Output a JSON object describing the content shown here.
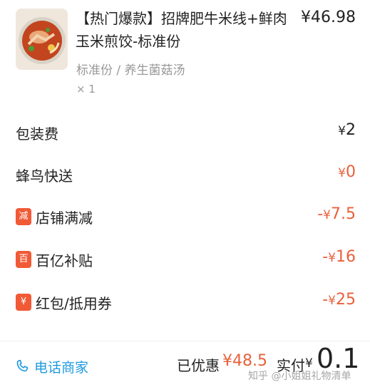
{
  "item": {
    "title": "【热门爆款】招牌肥牛米线+鲜肉玉米煎饺-标准份",
    "price": "¥46.98",
    "spec": "标准份 / 养生菌菇汤",
    "quantity": "× 1"
  },
  "fees": [
    {
      "label": "包装费",
      "yen": "¥",
      "amount": "2",
      "sign": ""
    },
    {
      "label": "蜂鸟快送",
      "yen": "¥",
      "amount": "0",
      "sign": ""
    }
  ],
  "discounts": [
    {
      "badge": "减",
      "label": "店铺满减",
      "sign": "-",
      "yen": "¥",
      "amount": "7.5"
    },
    {
      "badge": "百",
      "label": "百亿补贴",
      "sign": "-",
      "yen": "¥",
      "amount": "16"
    },
    {
      "badge": "¥",
      "label": "红包/抵用券",
      "sign": "-",
      "yen": "¥",
      "amount": "25"
    }
  ],
  "footer": {
    "call_label": "电话商家",
    "saved_label": "已优惠",
    "saved_amount": "¥48.5",
    "paid_label": "实付",
    "paid_yen": "¥",
    "paid_amount": "0.1",
    "watermark": "知乎 @小姐姐礼物清单"
  },
  "colors": {
    "accent_orange": "#e8613c",
    "badge_red": "#f05a36",
    "link_blue": "#1e9ae0"
  },
  "icons": {
    "phone": "phone-icon"
  }
}
